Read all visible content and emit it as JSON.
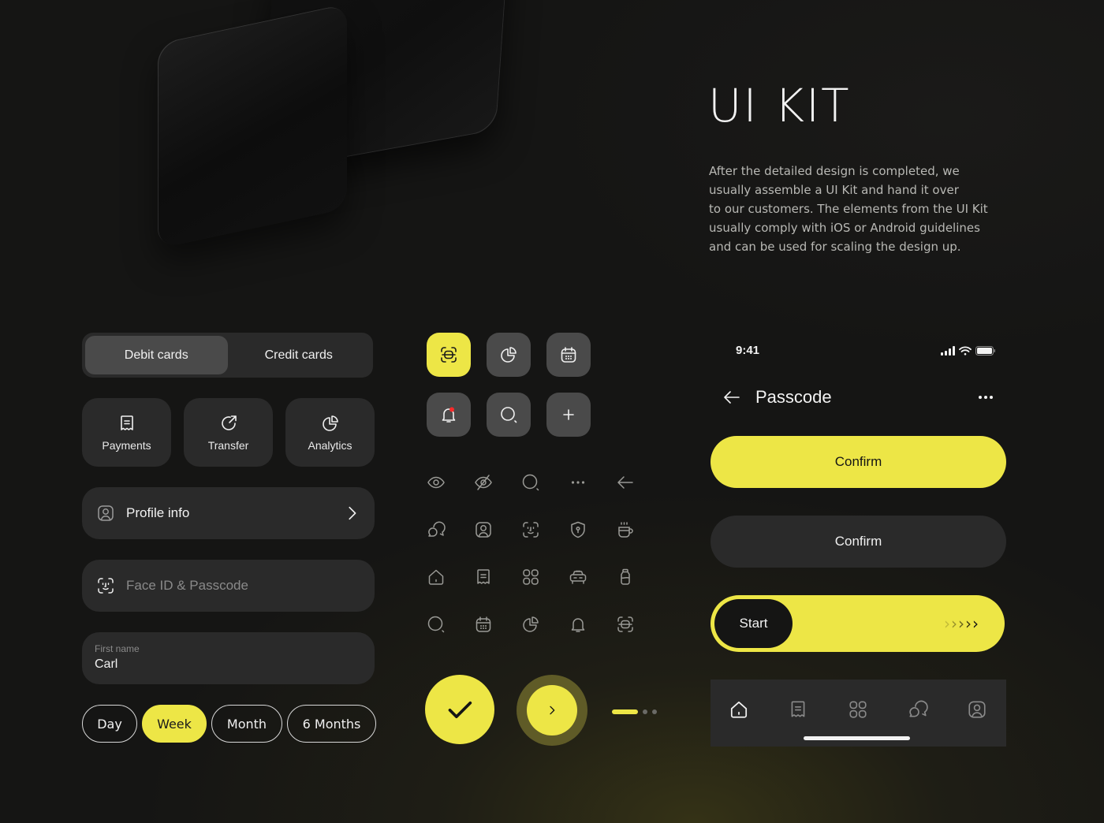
{
  "hero": {
    "title": "UI KIT",
    "description_lines": [
      "After the detailed design is completed, we",
      "usually assemble a UI Kit and hand it over",
      "to our customers. The elements from the UI Kit",
      "usually comply with iOS or Android guidelines",
      "and can be used for scaling the design up."
    ]
  },
  "segmented": {
    "options": [
      "Debit cards",
      "Credit cards"
    ],
    "selected": "Debit cards"
  },
  "actions": [
    {
      "label": "Payments",
      "icon": "receipt-icon"
    },
    {
      "label": "Transfer",
      "icon": "transfer-arrow-icon"
    },
    {
      "label": "Analytics",
      "icon": "pie-chart-icon"
    }
  ],
  "list_rows": {
    "profile": {
      "label": "Profile info",
      "icon": "user-square-icon",
      "trailing": "chevron-right-icon"
    },
    "face_id": {
      "label": "Face ID & Passcode",
      "icon": "face-id-icon"
    }
  },
  "first_name_field": {
    "label": "First name",
    "value": "Carl"
  },
  "period_chips": {
    "options": [
      "Day",
      "Week",
      "Month",
      "6 Months"
    ],
    "selected": "Week"
  },
  "icon_buttons": [
    {
      "icon": "scan-icon",
      "style": "yellow"
    },
    {
      "icon": "pie-chart-icon",
      "style": "gray"
    },
    {
      "icon": "calendar-icon",
      "style": "gray"
    },
    {
      "icon": "bell-icon",
      "style": "gray",
      "badge": true
    },
    {
      "icon": "search-icon",
      "style": "gray"
    },
    {
      "icon": "plus-icon",
      "style": "gray"
    }
  ],
  "icon_set": [
    [
      "eye-icon",
      "eye-off-icon",
      "search-icon",
      "more-horizontal-icon",
      "arrow-left-icon"
    ],
    [
      "chat-bubbles-icon",
      "user-square-icon",
      "face-id-icon",
      "shield-lock-icon",
      "coffee-cup-icon"
    ],
    [
      "home-icon",
      "receipt-icon",
      "grid-icon",
      "car-icon",
      "bottle-icon"
    ],
    [
      "search-icon",
      "calendar-icon",
      "pie-chart-icon",
      "bell-icon",
      "scan-icon"
    ]
  ],
  "controls": {
    "check_button_icon": "check-icon",
    "next_button_icon": "chevron-right-icon",
    "pager": {
      "count": 3,
      "active_index": 0
    }
  },
  "phone": {
    "status_bar": {
      "time": "9:41",
      "icons": [
        "signal-icon",
        "wifi-icon",
        "battery-icon"
      ]
    },
    "nav": {
      "title": "Passcode",
      "back_icon": "arrow-left-icon",
      "menu_icon": "more-horizontal-icon"
    },
    "primary_button": "Confirm",
    "secondary_button": "Confirm",
    "slider": {
      "label": "Start",
      "arrows": ">>>>>"
    },
    "tab_bar": {
      "items": [
        "home-icon",
        "receipt-icon",
        "grid-icon",
        "chat-bubbles-icon",
        "user-square-icon"
      ],
      "active": "home-icon"
    }
  },
  "colors": {
    "accent": "#ede646",
    "background": "#151514",
    "surface": "#2a2a2a",
    "surface_active": "#4a4a4a",
    "badge": "#ff2a2a"
  }
}
